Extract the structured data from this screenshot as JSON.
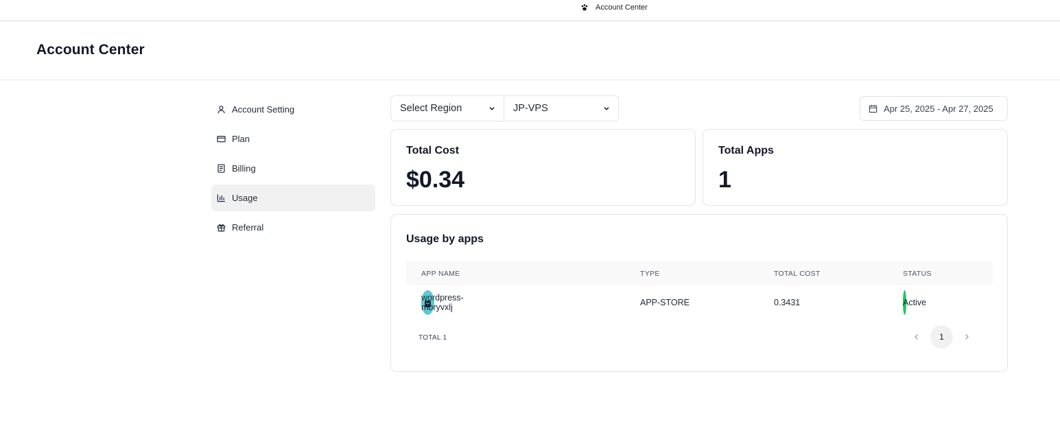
{
  "window": {
    "title": "Account Center",
    "icon": "paw-icon"
  },
  "header": {
    "title": "Account Center"
  },
  "sidebar": {
    "items": [
      {
        "label": "Account Setting",
        "icon": "user-icon",
        "active": false
      },
      {
        "label": "Plan",
        "icon": "credit-card-icon",
        "active": false
      },
      {
        "label": "Billing",
        "icon": "receipt-icon",
        "active": false
      },
      {
        "label": "Usage",
        "icon": "bar-chart-icon",
        "active": true
      },
      {
        "label": "Referral",
        "icon": "gift-icon",
        "active": false
      }
    ]
  },
  "filters": {
    "region": {
      "value": "Select Region"
    },
    "server": {
      "value": "JP-VPS"
    },
    "date_range": {
      "value": "Apr 25, 2025 - Apr 27, 2025",
      "icon": "calendar-icon"
    }
  },
  "stats": {
    "total_cost": {
      "label": "Total Cost",
      "value": "$0.34"
    },
    "total_apps": {
      "label": "Total Apps",
      "value": "1"
    }
  },
  "usage": {
    "title": "Usage by apps",
    "columns": [
      "APP NAME",
      "TYPE",
      "TOTAL COST",
      "STATUS"
    ],
    "rows": [
      {
        "app_name": "wordpress-mbryvxlj",
        "type": "APP-STORE",
        "total_cost": "0.3431",
        "status": "Active"
      }
    ],
    "total_label": "TOTAL 1",
    "pagination": {
      "current_page": "1"
    }
  },
  "colors": {
    "accent_bg": "#f1f1f2",
    "status_active": "#22c55e",
    "border": "#e3e4e8"
  }
}
